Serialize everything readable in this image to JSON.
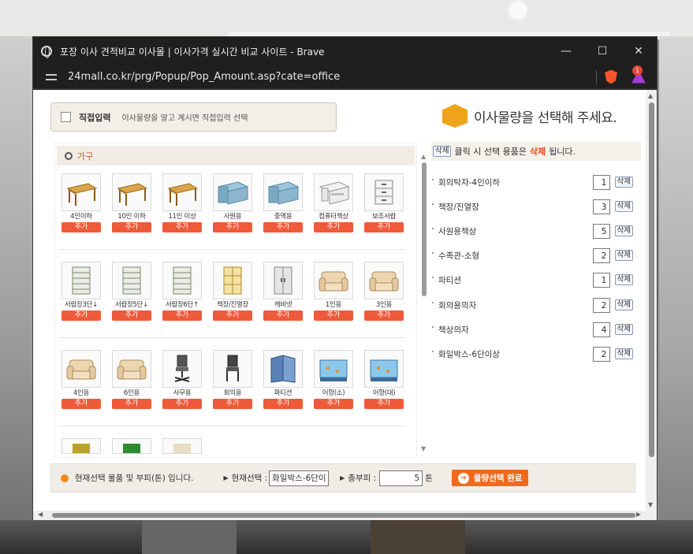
{
  "window": {
    "title": "포장 이사 견적비교 이사몰 | 이사가격 실시간 비교 사이트 - Brave",
    "url": "24mall.co.kr/prg/Popup/Pop_Amount.asp?cate=office",
    "controls": {
      "minimize": "—",
      "maximize": "☐",
      "close": "✕"
    },
    "rewards_badge": "1"
  },
  "direct_input": {
    "label": "직접입력",
    "description": "이사물량을 알고 계시면 직접입력 선택"
  },
  "heading": "이사물량을 선택해 주세요.",
  "category": "가구",
  "add_label": "추가",
  "items": [
    [
      {
        "name": "4인이하",
        "icon": "table-icon"
      },
      {
        "name": "10인 이하",
        "icon": "table-icon"
      },
      {
        "name": "11인 이상",
        "icon": "table-icon"
      },
      {
        "name": "사원용",
        "icon": "desk-icon"
      },
      {
        "name": "중역용",
        "icon": "desk-icon"
      },
      {
        "name": "컴퓨터책상",
        "icon": "computer-desk-icon"
      },
      {
        "name": "보조서랍",
        "icon": "drawer-icon"
      }
    ],
    [
      {
        "name": "서랍장3단↓",
        "icon": "cabinet-icon"
      },
      {
        "name": "서랍장5단↓",
        "icon": "cabinet-icon"
      },
      {
        "name": "서랍장6단↑",
        "icon": "cabinet-icon"
      },
      {
        "name": "책장/진열장",
        "icon": "bookcase-icon"
      },
      {
        "name": "캐비넷",
        "icon": "locker-icon"
      },
      {
        "name": "1인용",
        "icon": "sofa-icon"
      },
      {
        "name": "3인용",
        "icon": "sofa-icon"
      }
    ],
    [
      {
        "name": "4인용",
        "icon": "sofa-icon"
      },
      {
        "name": "6인용",
        "icon": "sofa-icon"
      },
      {
        "name": "사무용",
        "icon": "office-chair-icon"
      },
      {
        "name": "회의용",
        "icon": "chair-icon"
      },
      {
        "name": "파티션",
        "icon": "partition-icon"
      },
      {
        "name": "어항(소)",
        "icon": "fish-tank-icon"
      },
      {
        "name": "어항(대)",
        "icon": "fish-tank-icon"
      }
    ]
  ],
  "selected_panel": {
    "delete_button": "삭제",
    "hint_mid": "클릭 시 선택 용품은",
    "hint_word": "삭제",
    "hint_end": "됩니다.",
    "rows": [
      {
        "name": "회의탁자-4인이하",
        "qty": "1"
      },
      {
        "name": "책장/진열장",
        "qty": "3"
      },
      {
        "name": "사원용책상",
        "qty": "5"
      },
      {
        "name": "수족관-소형",
        "qty": "2"
      },
      {
        "name": "파티션",
        "qty": "1"
      },
      {
        "name": "회의용의자",
        "qty": "2"
      },
      {
        "name": "책상의자",
        "qty": "4"
      },
      {
        "name": "화일박스-6단이상",
        "qty": "2"
      }
    ]
  },
  "bottom": {
    "info": "현재선택 물품 및 부피(톤) 입니다.",
    "current_label": "현재선택 :",
    "current_value": "화일박스-6단이",
    "volume_label": "총부피 :",
    "volume_value": "5",
    "unit": "톤",
    "confirm": "물량선택 완료"
  }
}
